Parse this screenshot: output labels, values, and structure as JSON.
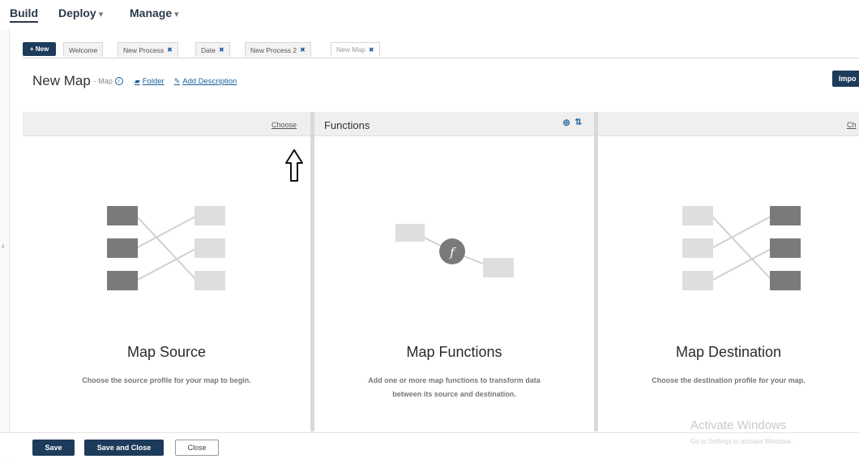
{
  "topnav": {
    "build": "Build",
    "deploy": "Deploy",
    "manage": "Manage",
    "caret": "▾"
  },
  "tabs": {
    "new_button": "+ New",
    "items": [
      {
        "label": "Welcome",
        "closable": false
      },
      {
        "label": "New Process",
        "closable": true
      },
      {
        "label": "Date",
        "closable": true
      },
      {
        "label": "New Process 2",
        "closable": true
      },
      {
        "label": "New Map",
        "closable": true,
        "active": true
      }
    ],
    "close_glyph": "✖"
  },
  "titlebar": {
    "title": "New Map",
    "subtitle": "- Map",
    "info": "i",
    "folder_label": "Folder",
    "add_description_label": "Add Description",
    "import_label": "Impo"
  },
  "panes": {
    "source": {
      "choose_label": "Choose",
      "heading": "Map Source",
      "description": "Choose the source profile for your map to begin."
    },
    "functions": {
      "header_title": "Functions",
      "heading": "Map Functions",
      "description_line1": "Add one or more map functions to transform data",
      "description_line2": "between its source and destination.",
      "function_glyph": "f"
    },
    "destination": {
      "choose_label": "Ch",
      "heading": "Map Destination",
      "description": "Choose the destination profile for your map."
    }
  },
  "footer": {
    "save_label": "Save",
    "save_close_label": "Save and Close",
    "close_label": "Close"
  },
  "watermark": {
    "title": "Activate Windows",
    "subtitle": "Go to Settings to activate Windows."
  },
  "colors": {
    "primary": "#1d3b5a",
    "link": "#1b5e9e",
    "dark_box": "#7a7a7a",
    "light_box": "#dedede"
  }
}
